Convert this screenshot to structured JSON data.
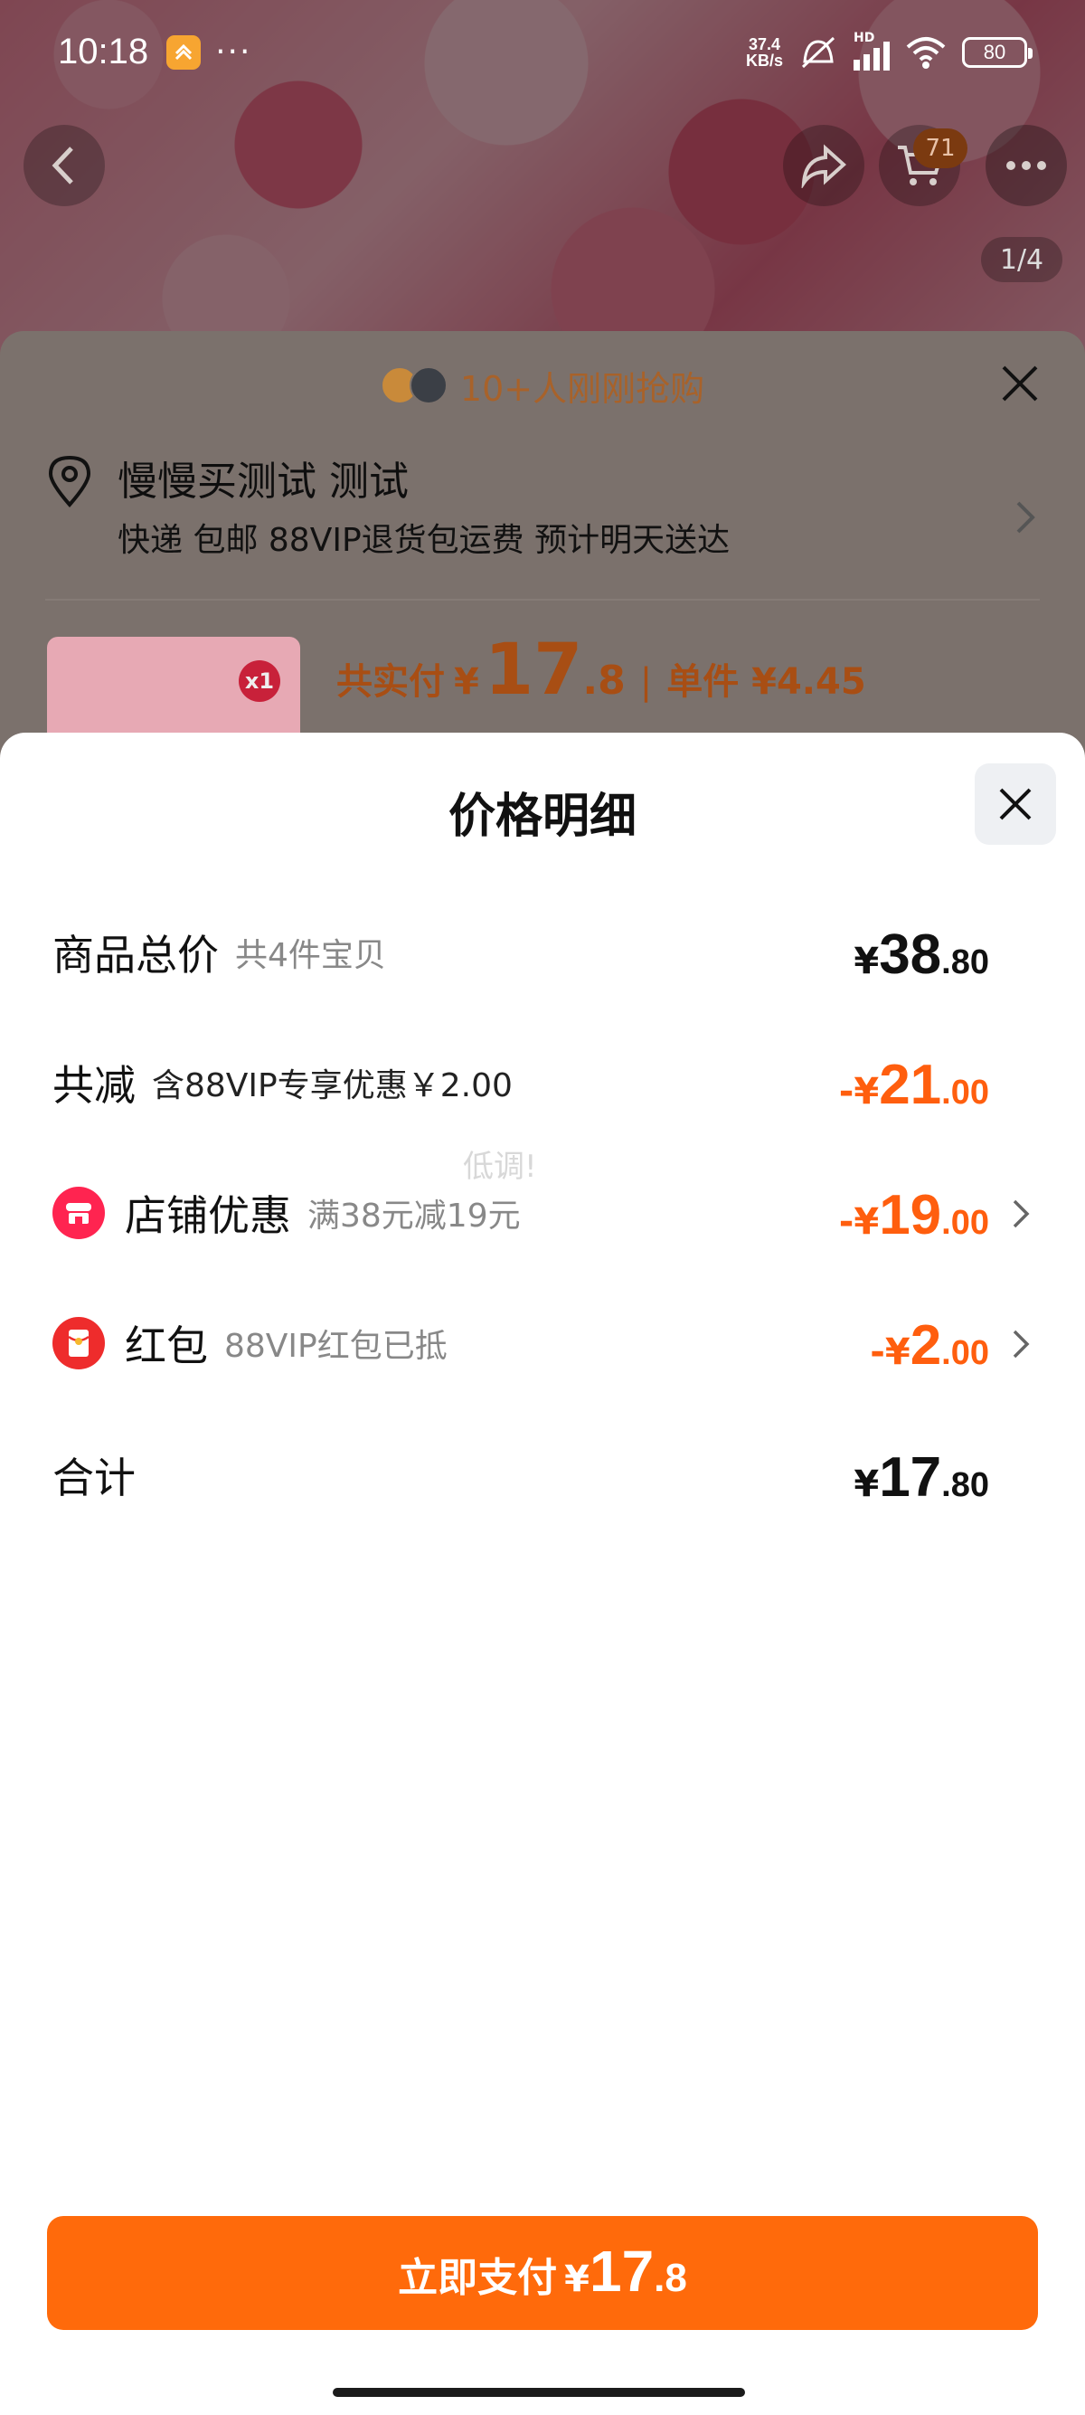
{
  "status_bar": {
    "time": "10:18",
    "net_speed_value": "37.4",
    "net_speed_unit": "KB/s",
    "network_label": "HD",
    "battery": "80",
    "more": "···"
  },
  "product_page": {
    "cart_count": "71",
    "image_counter": "1/4",
    "buyers_text": "10+人刚刚抢购",
    "address_name": "慢慢买测试 测试",
    "delivery_text": "快递 包邮 88VIP退货包运费 预计明天送达",
    "quantity_badge": "x1",
    "total_paid_label": "共实付",
    "total_paid_currency": "¥",
    "total_paid_int": "17",
    "total_paid_dec": ".8",
    "separator": "|",
    "unit_price_text": "单件 ¥4.45"
  },
  "price_sheet": {
    "title": "价格明细",
    "rows": [
      {
        "label": "商品总价",
        "sub": "共4件宝贝",
        "currency": "¥",
        "int": "38",
        "dec": ".80"
      },
      {
        "label": "共减",
        "sub": "含88VIP专享优惠￥2.00",
        "currency": "-¥",
        "int": "21",
        "dec": ".00"
      },
      {
        "label": "店铺优惠",
        "sub": "满38元减19元",
        "currency": "-¥",
        "int": "19",
        "dec": ".00"
      },
      {
        "label": "红包",
        "sub": "88VIP红包已抵",
        "currency": "-¥",
        "int": "2",
        "dec": ".00"
      },
      {
        "label": "合计",
        "currency": "¥",
        "int": "17",
        "dec": ".80"
      }
    ],
    "watermark": "低调!"
  },
  "pay_button": {
    "label": "立即支付",
    "currency": "¥",
    "int": "17",
    "dec": ".8"
  },
  "icons": {
    "store": "store-icon",
    "red_packet": "red-packet-icon",
    "close": "close-icon",
    "location": "location-pin-icon",
    "chevron": "chevron-right-icon"
  },
  "colors": {
    "accent_orange": "#ff6a0b",
    "discount_orange": "#ff5e0e",
    "store_icon_red": "#ff2450",
    "red_packet_red": "#ee2c2c"
  }
}
